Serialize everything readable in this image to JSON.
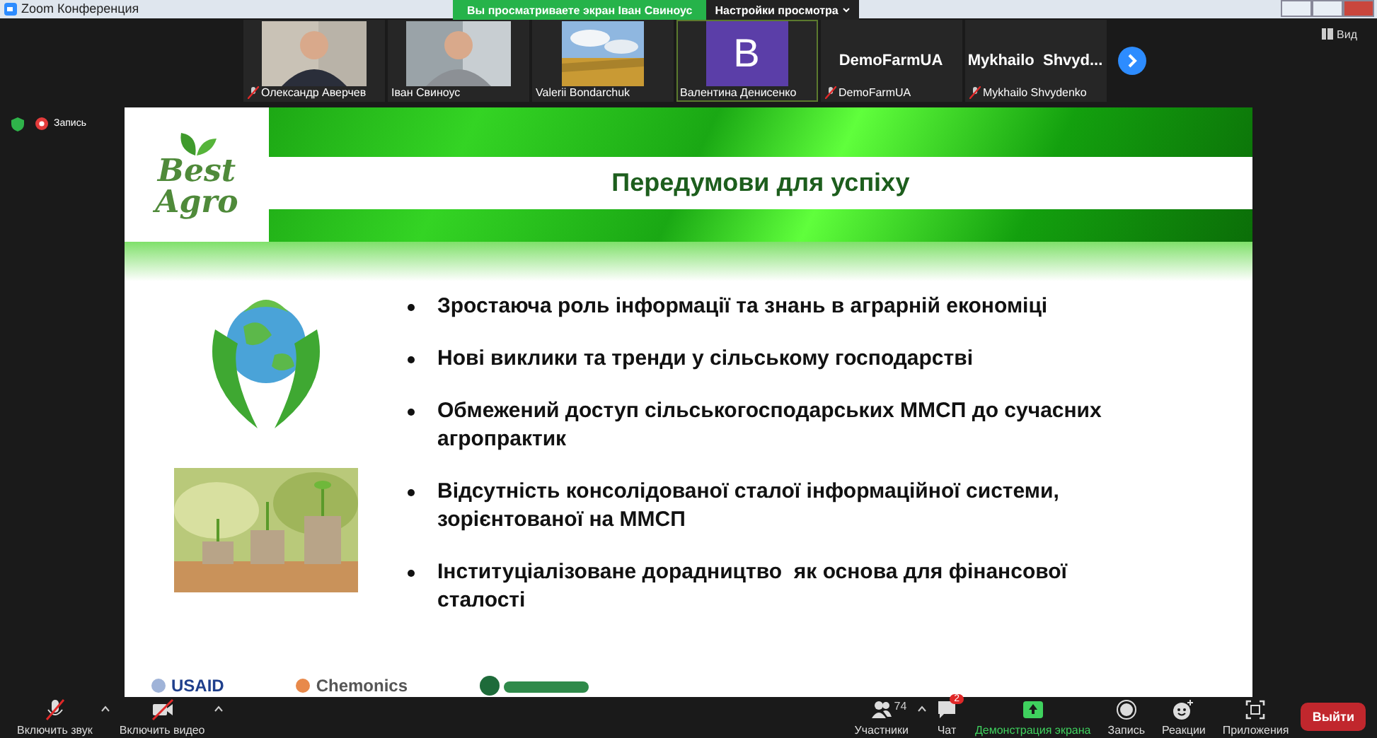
{
  "window": {
    "title": "Zoom Конференция"
  },
  "share_banner": {
    "text": "Вы просматриваете экран Іван Свиноус",
    "options": "Настройки просмотра"
  },
  "view_button": "Вид",
  "recording": {
    "label": "Запись"
  },
  "participants": [
    {
      "name": "Олександр Аверчев",
      "muted": true,
      "selected": false
    },
    {
      "name": "Іван Свиноус",
      "muted": false,
      "selected": false
    },
    {
      "kind": "picture",
      "name": "Valerii Bondarchuk",
      "muted": false,
      "selected": false
    },
    {
      "kind": "initial",
      "initial": "B",
      "name": "Валентина Денисенко",
      "muted": false,
      "selected": true
    },
    {
      "kind": "text",
      "display": "DemoFarmUA",
      "name": "DemoFarmUA",
      "muted": true,
      "selected": false
    },
    {
      "kind": "text",
      "display": "Mykhailo  Shvyd...",
      "name": "Mykhailo Shvydenko",
      "muted": true,
      "selected": false
    }
  ],
  "slide": {
    "title": "Передумови для успіху",
    "logo": [
      "Best",
      "Agro"
    ],
    "bullets": [
      "Зростаюча роль інформації та знань в аграрній економіці",
      "Нові виклики та тренди у сільському господарстві",
      "Обмежений доступ сільськогосподарських ММСП до сучасних агропрактик",
      "Відсутність консолідованої сталої інформаційної системи, зорієнтованої на ММСП",
      "Інституціалізоване дорадництво  як основа для фінансової сталості"
    ],
    "partners": [
      "USAID",
      "Chemonics"
    ]
  },
  "toolbar": [
    {
      "kind": "mic",
      "label": "Включить звук",
      "off": true,
      "caret": true
    },
    {
      "kind": "video",
      "label": "Включить видео",
      "off": true,
      "caret": true
    },
    {
      "kind": "participants",
      "label": "Участники",
      "count": "74",
      "caret": true
    },
    {
      "kind": "chat",
      "label": "Чат",
      "badge": "2"
    },
    {
      "kind": "share",
      "label": "Демонстрация экрана",
      "active": true
    },
    {
      "kind": "record",
      "label": "Запись"
    },
    {
      "kind": "reactions",
      "label": "Реакции"
    },
    {
      "kind": "apps",
      "label": "Приложения"
    }
  ],
  "leave_button": "Выйти"
}
